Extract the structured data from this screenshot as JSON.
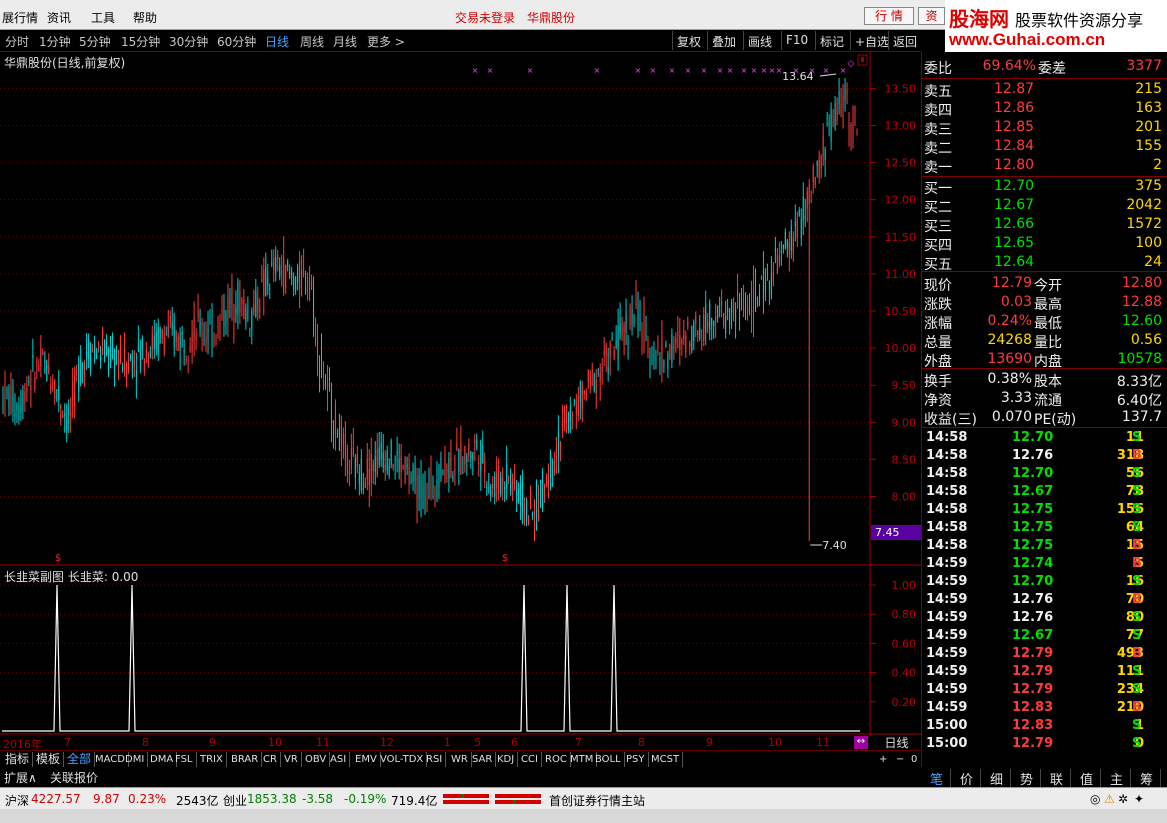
{
  "menu": {
    "items": [
      "展行情",
      "资讯",
      "工具",
      "帮助"
    ],
    "login_status": "交易未登录",
    "stock_name": "华鼎股份",
    "btn_quote": "行 情",
    "btn_trade": "资"
  },
  "logo": {
    "brand": "股海网",
    "tagline": "股票软件资源分享",
    "url": "www.Guhai.com.cn"
  },
  "periods": {
    "items": [
      "分时",
      "1分钟",
      "5分钟",
      "15分钟",
      "30分钟",
      "60分钟",
      "日线",
      "周线",
      "月线",
      "更多 >"
    ],
    "active": "日线"
  },
  "toolbar": [
    "复权",
    "叠加",
    "画线",
    "F10",
    "标记",
    "+自选",
    "返回"
  ],
  "chart": {
    "title": "华鼎股份(日线,前复权)",
    "price_axis": [
      "13.50",
      "13.00",
      "12.50",
      "12.00",
      "11.50",
      "11.00",
      "10.50",
      "10.00",
      "9.50",
      "9.00",
      "8.50",
      "8.00"
    ],
    "high_label": "13.64",
    "low_label": "7.40",
    "current_axis_label": "7.45",
    "sub_title": "长韭菜副图",
    "sub_value": "长韭菜: 0.00",
    "sub_axis": [
      "1.00",
      "0.80",
      "0.60",
      "0.40",
      "0.20"
    ],
    "date_labels": [
      "2016年",
      "7",
      "8",
      "9",
      "10",
      "11",
      "12",
      "1",
      "5",
      "6",
      "7",
      "8",
      "9",
      "10",
      "11"
    ],
    "period_label": "日线"
  },
  "chart_data": {
    "type": "candlestick",
    "price_ylim": [
      7.4,
      13.64
    ],
    "marked_high": 13.64,
    "marked_low": 7.4,
    "sub_indicator": {
      "name": "长韭菜",
      "type": "line",
      "ylim": [
        0,
        1
      ],
      "spike_positions_bar_index": [
        18,
        43,
        172,
        187,
        202
      ],
      "value": 0.0
    }
  },
  "tabs": {
    "left": [
      "指标",
      "模板"
    ],
    "items": [
      "全部",
      "MACD",
      "DMI",
      "DMA",
      "FSL",
      "TRIX",
      "BRAR",
      "CR",
      "VR",
      "OBV",
      "ASI",
      "EMV",
      "VOL-TDX",
      "RSI",
      "WR",
      "SAR",
      "KDJ",
      "CCI",
      "ROC",
      "MTM",
      "BOLL",
      "PSY",
      "MCST"
    ],
    "active": "全部",
    "sub_items": [
      "扩展∧",
      "关联报价"
    ]
  },
  "panel": {
    "wb_label": "委比",
    "wb_value": "69.64%",
    "wc_label": "委差",
    "wc_value": "3377",
    "asks": [
      {
        "label": "卖五",
        "price": "12.87",
        "vol": "215"
      },
      {
        "label": "卖四",
        "price": "12.86",
        "vol": "163"
      },
      {
        "label": "卖三",
        "price": "12.85",
        "vol": "201"
      },
      {
        "label": "卖二",
        "price": "12.84",
        "vol": "155"
      },
      {
        "label": "卖一",
        "price": "12.80",
        "vol": "2"
      }
    ],
    "bids": [
      {
        "label": "买一",
        "price": "12.70",
        "vol": "375"
      },
      {
        "label": "买二",
        "price": "12.67",
        "vol": "2042"
      },
      {
        "label": "买三",
        "price": "12.66",
        "vol": "1572"
      },
      {
        "label": "买四",
        "price": "12.65",
        "vol": "100"
      },
      {
        "label": "买五",
        "price": "12.64",
        "vol": "24"
      }
    ],
    "quote": [
      {
        "l1": "现价",
        "v1": "12.79",
        "c1": "red",
        "l2": "今开",
        "v2": "12.80",
        "c2": "red"
      },
      {
        "l1": "涨跌",
        "v1": "0.03",
        "c1": "red",
        "l2": "最高",
        "v2": "12.88",
        "c2": "red"
      },
      {
        "l1": "涨幅",
        "v1": "0.24%",
        "c1": "red",
        "l2": "最低",
        "v2": "12.60",
        "c2": "grn"
      },
      {
        "l1": "总量",
        "v1": "24268",
        "c1": "yel",
        "l2": "量比",
        "v2": "0.56",
        "c2": "yel"
      },
      {
        "l1": "外盘",
        "v1": "13690",
        "c1": "red",
        "l2": "内盘",
        "v2": "10578",
        "c2": "grn"
      }
    ],
    "fund": [
      {
        "l1": "换手",
        "v1": "0.38%",
        "l2": "股本",
        "v2": "8.33亿"
      },
      {
        "l1": "净资",
        "v1": "3.33",
        "l2": "流通",
        "v2": "6.40亿"
      },
      {
        "l1": "收益(三)",
        "v1": "0.070",
        "l2": "PE(动)",
        "v2": "137.7"
      }
    ],
    "ticks": [
      {
        "t": "14:58",
        "p": "12.70",
        "pc": "grn",
        "v": "11",
        "s": "S"
      },
      {
        "t": "14:58",
        "p": "12.76",
        "pc": "wht",
        "v": "318",
        "s": "B"
      },
      {
        "t": "14:58",
        "p": "12.70",
        "pc": "grn",
        "v": "56",
        "s": "S"
      },
      {
        "t": "14:58",
        "p": "12.67",
        "pc": "grn",
        "v": "78",
        "s": "S"
      },
      {
        "t": "14:58",
        "p": "12.75",
        "pc": "grn",
        "v": "156",
        "s": "S"
      },
      {
        "t": "14:58",
        "p": "12.75",
        "pc": "grn",
        "v": "64",
        "s": "S"
      },
      {
        "t": "14:58",
        "p": "12.75",
        "pc": "grn",
        "v": "15",
        "s": "B"
      },
      {
        "t": "14:59",
        "p": "12.74",
        "pc": "grn",
        "v": "5",
        "s": "B"
      },
      {
        "t": "14:59",
        "p": "12.70",
        "pc": "grn",
        "v": "16",
        "s": "S"
      },
      {
        "t": "14:59",
        "p": "12.76",
        "pc": "wht",
        "v": "70",
        "s": "B"
      },
      {
        "t": "14:59",
        "p": "12.76",
        "pc": "wht",
        "v": "80",
        "s": "S"
      },
      {
        "t": "14:59",
        "p": "12.67",
        "pc": "grn",
        "v": "77",
        "s": "S"
      },
      {
        "t": "14:59",
        "p": "12.79",
        "pc": "red",
        "v": "493",
        "s": "B"
      },
      {
        "t": "14:59",
        "p": "12.79",
        "pc": "red",
        "v": "111",
        "s": "S"
      },
      {
        "t": "14:59",
        "p": "12.79",
        "pc": "red",
        "v": "234",
        "s": "S"
      },
      {
        "t": "14:59",
        "p": "12.83",
        "pc": "red",
        "v": "210",
        "s": "B"
      },
      {
        "t": "15:00",
        "p": "12.83",
        "pc": "red",
        "v": "1",
        "s": "S"
      },
      {
        "t": "15:00",
        "p": "12.79",
        "pc": "red",
        "v": "0",
        "s": "S"
      }
    ],
    "bottom_tabs": [
      "笔",
      "价",
      "细",
      "势",
      "联",
      "值",
      "主",
      "筹"
    ]
  },
  "status": {
    "sh_label": "沪深",
    "sh_value": "4227.57",
    "sh_chg": "9.87",
    "sh_pct": "0.23%",
    "sh_amt": "2543亿",
    "cy_label": "创业",
    "cy_value": "1853.38",
    "cy_chg": "-3.58",
    "cy_pct": "-0.19%",
    "cy_amt": "719.4亿",
    "site": "首创证券行情主站"
  },
  "colors": {
    "up": "#ff3c3c",
    "down": "#00d0d0",
    "bg": "#000000",
    "grid": "#a00000"
  }
}
